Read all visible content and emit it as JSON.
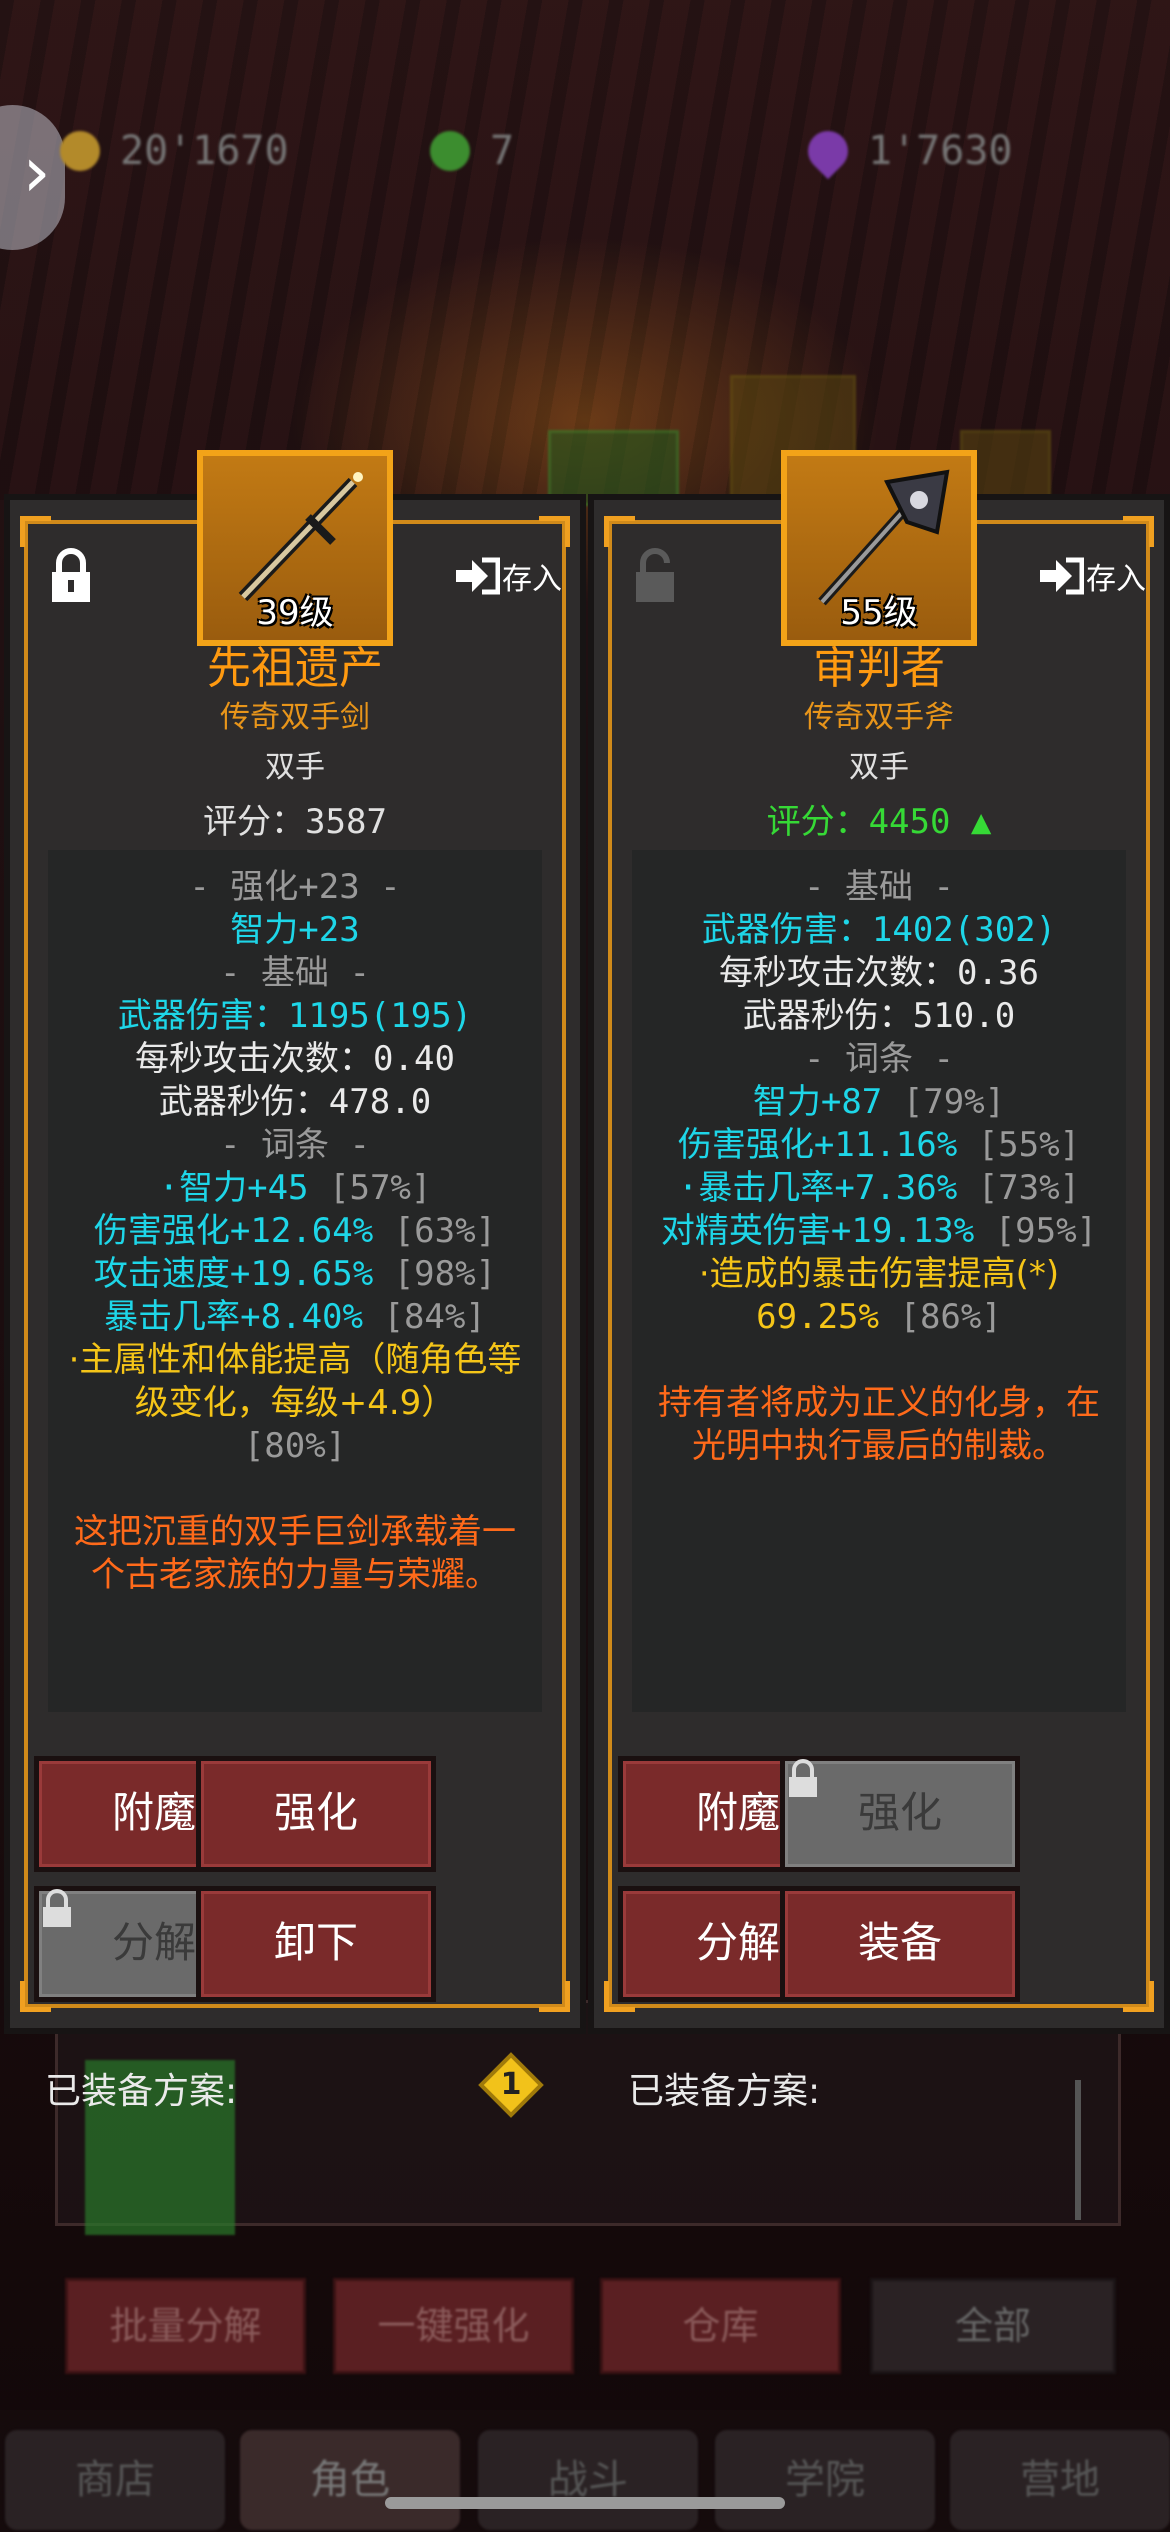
{
  "currencies": {
    "gold": "20'1670",
    "gems": "7",
    "souls": "1'7630"
  },
  "background": {
    "bottom_buttons": [
      "批量分解",
      "一键强化",
      "仓库",
      "全部"
    ],
    "tabs": [
      "商店",
      "角色",
      "战斗",
      "学院",
      "营地"
    ]
  },
  "left_item": {
    "level": "39级",
    "name": "先祖遗产",
    "type": "传奇双手剑",
    "hand": "双手",
    "score": "评分：3587",
    "store_label": "存入",
    "stats": {
      "enhance_header": "- 强化+23 -",
      "enhance_int": "智力+23",
      "base_header": "- 基础 -",
      "weapon_damage": "武器伤害：1195(195)",
      "attack_speed": "每秒攻击次数：0.40",
      "dps": "武器秒伤：478.0",
      "affix_header": "- 词条 -",
      "affix1": "·智力+45",
      "affix1_pct": "[57%]",
      "affix2": "伤害强化+12.64%",
      "affix2_pct": "[63%]",
      "affix3": "攻击速度+19.65%",
      "affix3_pct": "[98%]",
      "affix4": "暴击几率+8.40%",
      "affix4_pct": "[84%]",
      "affix5": "·主属性和体能提高（随角色等级变化，每级+4.9）",
      "affix5_pct": "[80%]",
      "flavor": "这把沉重的双手巨剑承载着一个古老家族的力量与荣耀。"
    },
    "buttons": {
      "enchant": "附魔",
      "upgrade": "强化",
      "salvage": "分解",
      "unequip": "卸下"
    }
  },
  "right_item": {
    "level": "55级",
    "name": "审判者",
    "type": "传奇双手斧",
    "hand": "双手",
    "score": "评分：4450 ▲",
    "store_label": "存入",
    "stats": {
      "base_header": "- 基础 -",
      "weapon_damage": "武器伤害：1402(302)",
      "attack_speed": "每秒攻击次数：0.36",
      "dps": "武器秒伤：510.0",
      "affix_header": "- 词条 -",
      "affix1": "智力+87",
      "affix1_pct": "[79%]",
      "affix2": "伤害强化+11.16%",
      "affix2_pct": "[55%]",
      "affix3": "·暴击几率+7.36%",
      "affix3_pct": "[73%]",
      "affix4": "对精英伤害+19.13%",
      "affix4_pct": "[95%]",
      "affix5": "·造成的暴击伤害提高(*)",
      "affix5_value": "69.25%",
      "affix5_pct": "[86%]",
      "flavor": "持有者将成为正义的化身，在光明中执行最后的制裁。"
    },
    "buttons": {
      "enchant": "附魔",
      "upgrade": "强化",
      "salvage": "分解",
      "equip": "装备"
    }
  },
  "equipped_label_left": "已装备方案:",
  "equipped_label_right": "已装备方案:",
  "equipped_badge": "1",
  "colors": {
    "frame": "#f0a020",
    "button": "#7a2a2a",
    "cyan_stat": "#1ed6e8",
    "yellow_stat": "#f5c518",
    "flavor": "#ff6a1a",
    "score_up": "#36d936"
  }
}
